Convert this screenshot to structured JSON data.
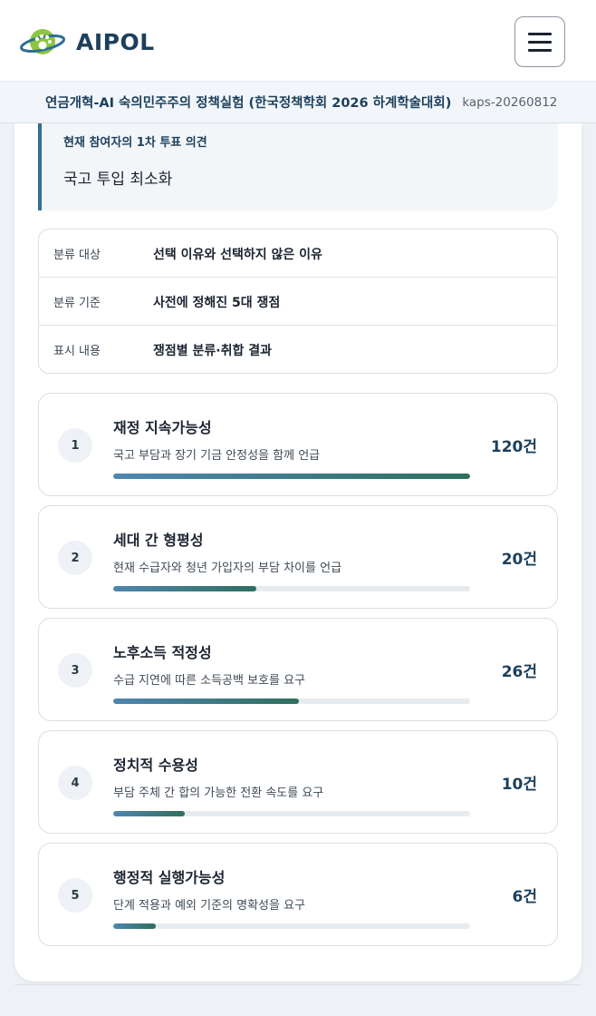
{
  "header": {
    "brand": "AIPOL",
    "logo_icon": "paw-planet-logo-icon",
    "menu_icon": "hamburger-menu-icon"
  },
  "infobar": {
    "title": "연금개혁-AI 숙의민주주의 정책실험 (한국정책학회 2026 하계학술대회)",
    "code": "kaps-20260812"
  },
  "opinion": {
    "label": "현재 참여자의 1차 투표 의견",
    "value": "국고 투입 최소화"
  },
  "meta": [
    {
      "key": "분류 대상",
      "value": "선택 이유와 선택하지 않은 이유"
    },
    {
      "key": "분류 기준",
      "value": "사전에 정해진 5대 쟁점"
    },
    {
      "key": "표시 내용",
      "value": "쟁점별 분류·취합 결과"
    }
  ],
  "issues": [
    {
      "num": "1",
      "title": "재정 지속가능성",
      "desc": "국고 부담과 장기 기금 안정성을 함께 언급",
      "count": "120건",
      "share": 1.0
    },
    {
      "num": "2",
      "title": "세대 간 형평성",
      "desc": "현재 수급자와 청년 가입자의 부담 차이를 언급",
      "count": "20건",
      "share": 0.4
    },
    {
      "num": "3",
      "title": "노후소득 적정성",
      "desc": "수급 지연에 따른 소득공백 보호를 요구",
      "count": "26건",
      "share": 0.52
    },
    {
      "num": "4",
      "title": "정치적 수용성",
      "desc": "부담 주체 간 합의 가능한 전환 속도를 요구",
      "count": "10건",
      "share": 0.2
    },
    {
      "num": "5",
      "title": "행정적 실행가능성",
      "desc": "단계 적용과 예외 기준의 명확성을 요구",
      "count": "6건",
      "share": 0.12
    }
  ],
  "colors": {
    "accent": "#1c3f5c",
    "bar_start": "#4f86b0",
    "bar_end": "#2f6f5e",
    "logo_green": "#8cc63f",
    "logo_ring": "#2f6f94"
  }
}
